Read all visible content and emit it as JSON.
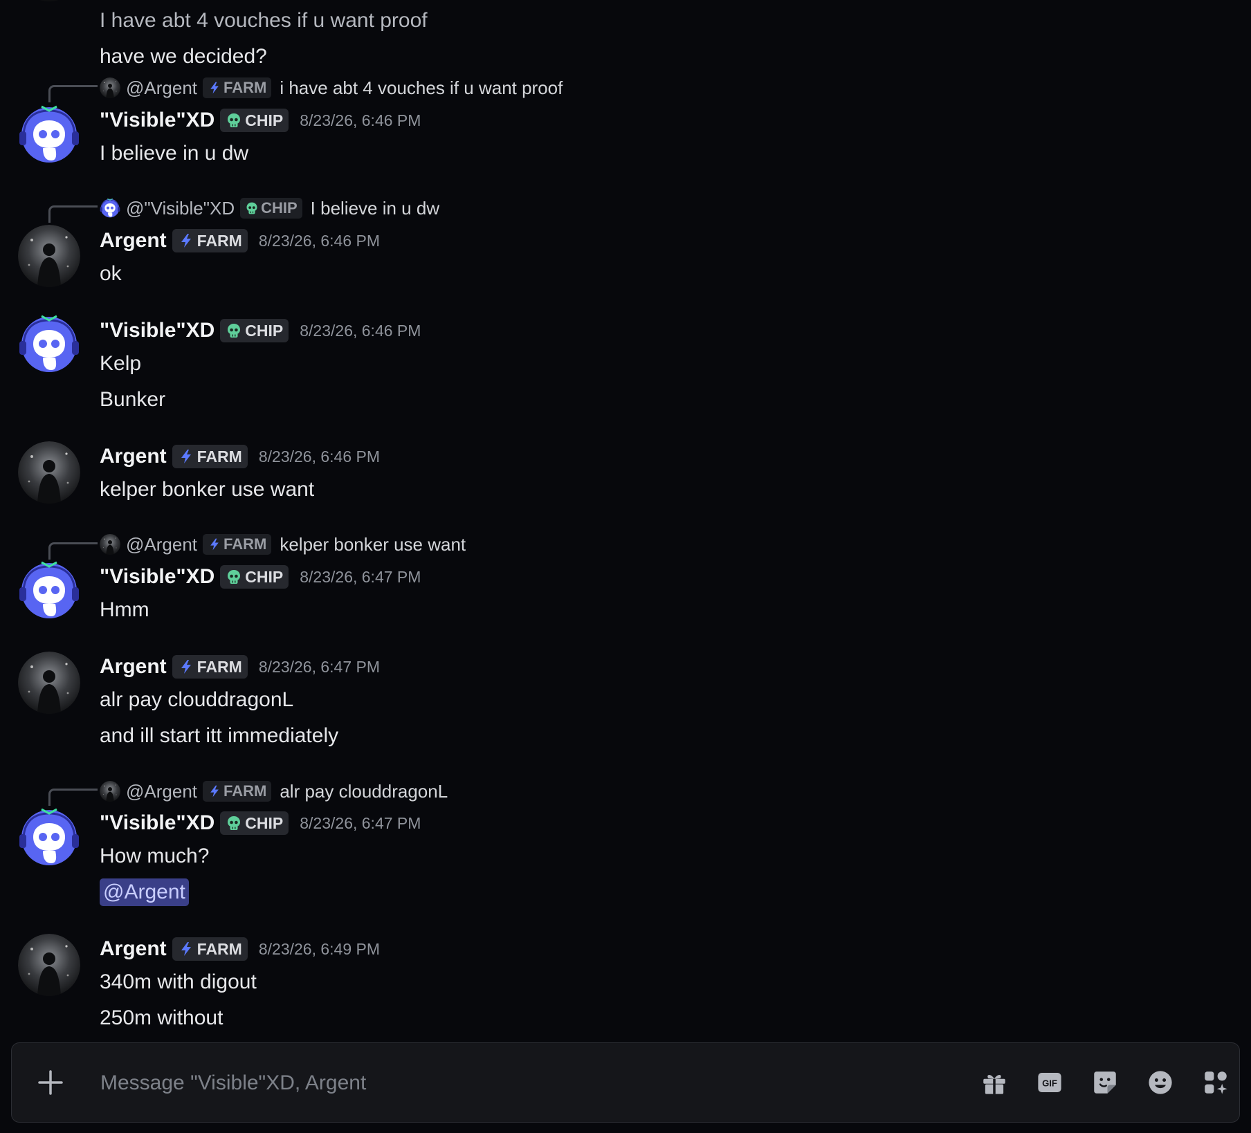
{
  "partial_top": {
    "text": "have we decided?"
  },
  "msg1": {
    "reply": {
      "name": "@Argent",
      "tag": "FARM",
      "text": "i have abt 4 vouches if u want proof"
    },
    "author": "\"Visible\"XD",
    "tag": "CHIP",
    "time": "8/23/26, 6:46 PM",
    "lines": [
      "I believe in u dw"
    ]
  },
  "msg2": {
    "reply": {
      "name": "@\"Visible\"XD",
      "tag": "CHIP",
      "text": "I believe in u dw"
    },
    "author": "Argent",
    "tag": "FARM",
    "time": "8/23/26, 6:46 PM",
    "lines": [
      "ok"
    ]
  },
  "msg3": {
    "author": "\"Visible\"XD",
    "tag": "CHIP",
    "time": "8/23/26, 6:46 PM",
    "lines": [
      "Kelp",
      "Bunker"
    ]
  },
  "msg4": {
    "author": "Argent",
    "tag": "FARM",
    "time": "8/23/26, 6:46 PM",
    "lines": [
      "kelper bonker use want"
    ]
  },
  "msg5": {
    "reply": {
      "name": "@Argent",
      "tag": "FARM",
      "text": "kelper bonker use want"
    },
    "author": "\"Visible\"XD",
    "tag": "CHIP",
    "time": "8/23/26, 6:47 PM",
    "lines": [
      "Hmm"
    ]
  },
  "msg6": {
    "author": "Argent",
    "tag": "FARM",
    "time": "8/23/26, 6:47 PM",
    "lines": [
      "alr pay clouddragonL",
      "and ill start itt immediately"
    ]
  },
  "msg7": {
    "reply": {
      "name": "@Argent",
      "tag": "FARM",
      "text": "alr pay clouddragonL"
    },
    "author": "\"Visible\"XD",
    "tag": "CHIP",
    "time": "8/23/26, 6:47 PM",
    "lines": [
      "How much?"
    ],
    "mention": "@Argent"
  },
  "msg8": {
    "author": "Argent",
    "tag": "FARM",
    "time": "8/23/26, 6:49 PM",
    "lines": [
      "340m with digout",
      "250m without"
    ]
  },
  "composer": {
    "placeholder": "Message \"Visible\"XD, Argent",
    "gif_label": "GIF"
  },
  "colors": {
    "background": "#07080c",
    "composer": "#15161a",
    "blurple": "#5865f2",
    "mention_bg": "#3a3f88",
    "farm_bolt": "#5b79ff",
    "chip_skull": "#5fcf9a"
  },
  "icons": [
    "plus-icon",
    "gift-icon",
    "gif-icon",
    "sticker-icon",
    "emoji-icon",
    "apps-icon",
    "lightning-icon",
    "skull-icon"
  ]
}
